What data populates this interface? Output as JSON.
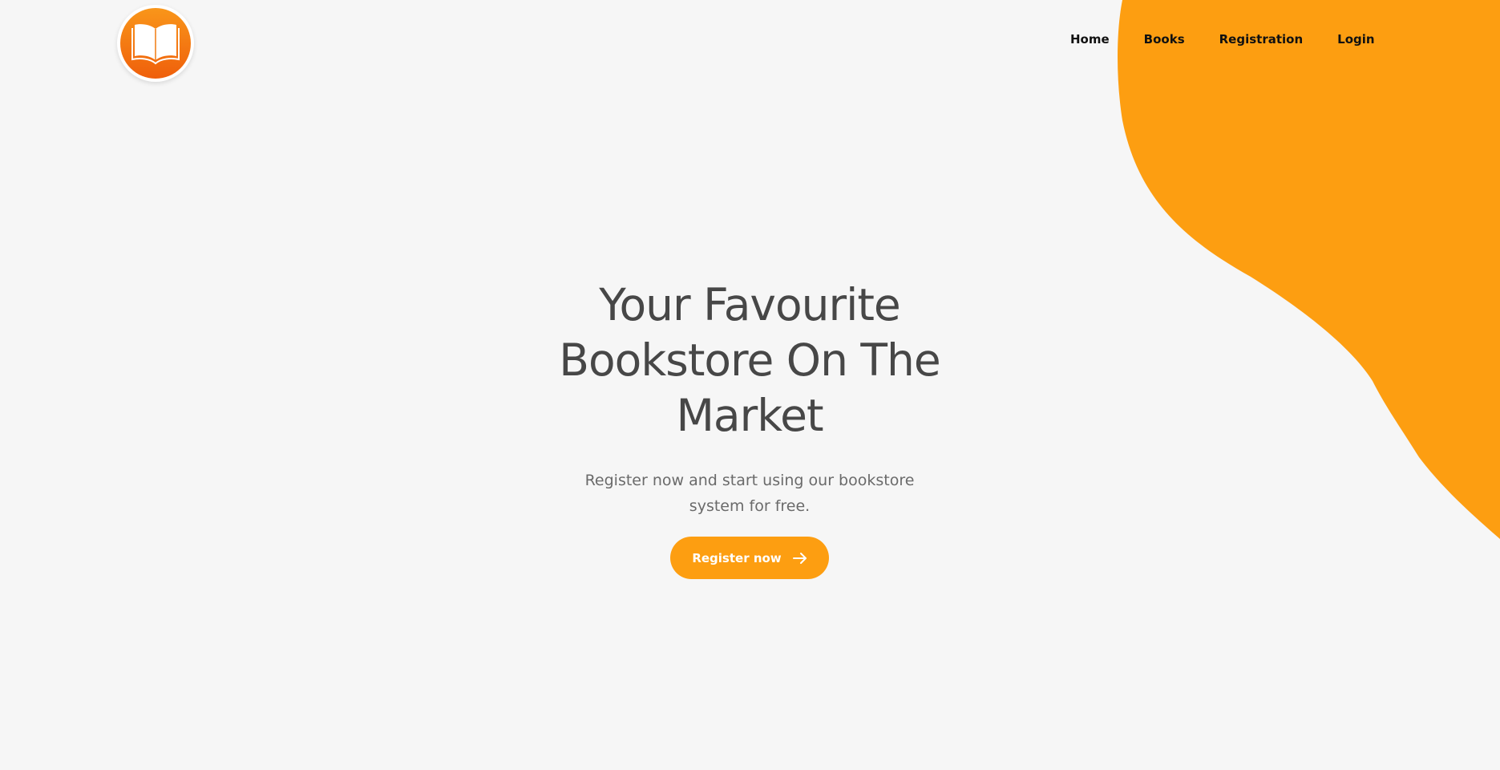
{
  "brand": {
    "logo_icon": "open-book-icon",
    "accent": "#fd9e11",
    "logo_gradient_top": "#f9961a",
    "logo_gradient_bottom": "#ef5f0b"
  },
  "nav": {
    "items": [
      {
        "label": "Home"
      },
      {
        "label": "Books"
      },
      {
        "label": "Registration"
      },
      {
        "label": "Login"
      }
    ]
  },
  "hero": {
    "title_line1": "Your Favourite",
    "title_line2": "Bookstore On The",
    "title_line3": "Market",
    "subtitle": "Register now and start using our bookstore system for free.",
    "cta_label": "Register now",
    "cta_icon": "arrow-right-icon"
  },
  "colors": {
    "background": "#f6f6f6",
    "blob": "#fd9e11",
    "heading": "#474747",
    "text": "#6a6a6a"
  }
}
